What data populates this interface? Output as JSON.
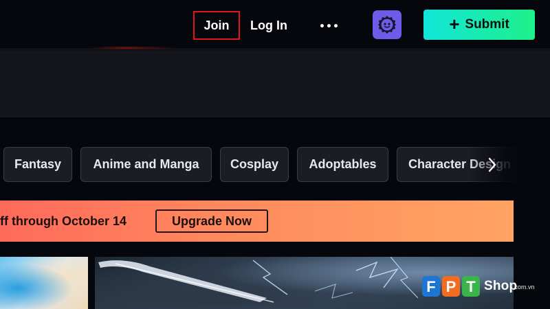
{
  "header": {
    "join_label": "Join",
    "login_label": "Log In",
    "more_icon": "ellipsis-icon",
    "avatar_icon": "gear-face-icon",
    "submit_label": "Submit",
    "submit_icon": "plus-icon",
    "colors": {
      "join_outline": "#e0161c",
      "avatar_bg": "#6c5ce7",
      "submit_gradient_start": "#11e6d8",
      "submit_gradient_end": "#1ef08a"
    }
  },
  "categories": {
    "items": [
      {
        "label": "Fantasy"
      },
      {
        "label": "Anime and Manga"
      },
      {
        "label": "Cosplay"
      },
      {
        "label": "Adoptables"
      },
      {
        "label": "Character Design"
      }
    ],
    "next_icon": "chevron-right-icon"
  },
  "promo": {
    "text": "ff through October 14",
    "button_label": "Upgrade Now",
    "colors": {
      "gradient_start": "#ff6a5b",
      "gradient_end": "#ffa463"
    }
  },
  "watermark": {
    "logo_text": "FPT",
    "shop_label": "Shop",
    "domain_suffix": ".com.vn"
  }
}
